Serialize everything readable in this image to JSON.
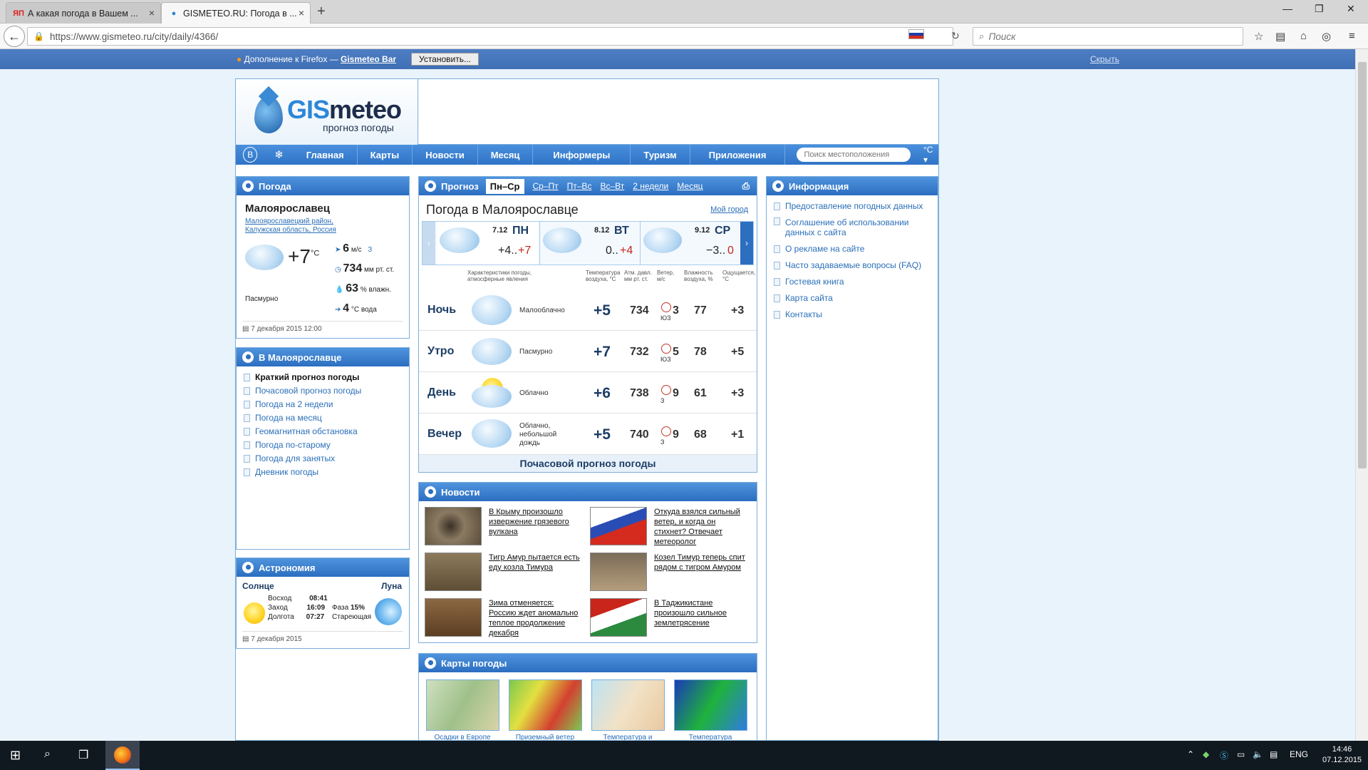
{
  "browser": {
    "tabs": [
      {
        "title": "А какая погода в Вашем ...",
        "favicon": "ЯП"
      },
      {
        "title": "GISMETEO.RU: Погода в ...",
        "favicon": "💧"
      }
    ],
    "url": "https://www.gismeteo.ru/city/daily/4366/",
    "search_placeholder": "Поиск",
    "addon_msg": "Дополнение к Firefox —",
    "addon_link": "Gismeteo Bar",
    "install": "Установить...",
    "hide": "Скрыть"
  },
  "header": {
    "brand_a": "GIS",
    "brand_b": "meteo",
    "tagline": "прогноз погоды"
  },
  "menu": {
    "items": [
      "Главная",
      "Карты",
      "Новости",
      "Месяц",
      "Информеры",
      "Туризм",
      "Приложения"
    ],
    "search_placeholder": "Поиск местоположения",
    "unit": "°C ▾"
  },
  "weather_panel": {
    "title": "Погода",
    "city": "Малоярославец",
    "district": "Малоярославецкий район,",
    "region": "Калужская область,",
    "country": "Россия",
    "temp": "+7",
    "temp_unit": "°C",
    "condition": "Пасмурно",
    "wind": "6",
    "wind_unit": "м/с",
    "wind_dir": "З",
    "pressure": "734",
    "pressure_unit": "мм рт. ст.",
    "humidity": "63",
    "humidity_unit": "% влажн.",
    "water": "4",
    "water_unit": "°C вода",
    "updated": "7 декабря 2015 12:00"
  },
  "city_panel": {
    "title": "В Малоярославце",
    "items": [
      "Краткий прогноз погоды",
      "Почасовой прогноз погоды",
      "Погода на 2 недели",
      "Погода на месяц",
      "Геомагнитная обстановка",
      "Погода по-старому",
      "Погода для занятых",
      "Дневник погоды"
    ]
  },
  "astro": {
    "title": "Астрономия",
    "sun": "Солнце",
    "moon": "Луна",
    "rise_l": "Восход",
    "rise": "08:41",
    "set_l": "Заход",
    "set": "16:09",
    "len_l": "Долгота",
    "len": "07:27",
    "phase_l": "Фаза",
    "phase": "15%",
    "moon_state": "Стареющая",
    "date": "7 декабря 2015"
  },
  "forecast": {
    "tab": "Прогноз",
    "tabs": [
      "Пн–Ср",
      "Ср–Пт",
      "Пт–Вс",
      "Вс–Вт",
      "2 недели",
      "Месяц"
    ],
    "title": "Погода в Малоярославце",
    "my_city": "Мой город",
    "days": [
      {
        "date": "7.12",
        "dow": "ПН",
        "min": "+4..",
        "max": "+7"
      },
      {
        "date": "8.12",
        "dow": "ВТ",
        "min": "0..",
        "max": "+4"
      },
      {
        "date": "9.12",
        "dow": "СР",
        "min": "−3..",
        "max": "0"
      }
    ],
    "headers": {
      "chars": "Характеристики погоды, атмосферные явления",
      "temp": "Температура воздуха, °C",
      "pres": "Атм. давл. мм рт. ст.",
      "wind": "Ветер, м/с",
      "hum": "Влажность воздуха, %",
      "feel": "Ощущается, °C"
    },
    "rows": [
      {
        "label": "Ночь",
        "desc": "Малооблачно",
        "temp": "+5",
        "pres": "734",
        "wind": "3",
        "dir": "ЮЗ",
        "hum": "77",
        "feel": "+3"
      },
      {
        "label": "Утро",
        "desc": "Пасмурно",
        "temp": "+7",
        "pres": "732",
        "wind": "5",
        "dir": "ЮЗ",
        "hum": "78",
        "feel": "+5"
      },
      {
        "label": "День",
        "desc": "Облачно",
        "temp": "+6",
        "pres": "738",
        "wind": "9",
        "dir": "З",
        "hum": "61",
        "feel": "+3"
      },
      {
        "label": "Вечер",
        "desc": "Облачно, небольшой дождь",
        "temp": "+5",
        "pres": "740",
        "wind": "9",
        "dir": "З",
        "hum": "68",
        "feel": "+1"
      }
    ],
    "hourly": "Почасовой прогноз погоды"
  },
  "news": {
    "title": "Новости",
    "items": [
      "В Крыму произошло извержение грязевого вулкана",
      "Откуда взялся сильный ветер, и когда он стихнет? Отвечает метеоролог",
      "Тигр Амур пытается есть еду козла Тимура",
      "Козел Тимур теперь спит рядом с тигром Амуром",
      "Зима отменяется: Россию ждет аномально теплое продолжение декабря",
      "В Таджикистане произошло сильное землетрясение"
    ]
  },
  "maps": {
    "title": "Карты погоды",
    "captions": [
      "Осадки в Европе",
      "Приземный ветер",
      "Температура и",
      "Температура"
    ]
  },
  "info": {
    "title": "Информация",
    "items": [
      "Предоставление погодных данных",
      "Соглашение об использовании данных с сайта",
      "О рекламе на сайте",
      "Часто задаваемые вопросы (FAQ)",
      "Гостевая книга",
      "Карта сайта",
      "Контакты"
    ]
  },
  "taskbar": {
    "lang": "ENG",
    "time": "14:46",
    "date": "07.12.2015"
  }
}
